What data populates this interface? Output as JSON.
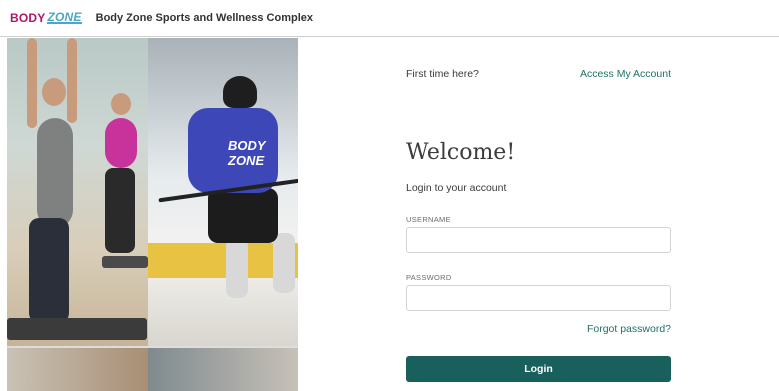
{
  "header": {
    "logo_body": "BODY",
    "logo_zone": "ZONE",
    "title": "Body Zone Sports and Wellness Complex"
  },
  "photos": {
    "jersey_text": "BODY ZONE"
  },
  "form": {
    "first_time": "First time here?",
    "access_link": "Access My Account",
    "welcome": "Welcome!",
    "subtitle": "Login to your account",
    "username_label": "USERNAME",
    "username_value": "",
    "password_label": "PASSWORD",
    "password_value": "",
    "forgot": "Forgot password?",
    "login_button": "Login"
  },
  "colors": {
    "brand_magenta": "#b0156a",
    "brand_cyan": "#4aa7c7",
    "accent_teal": "#19605c",
    "link_teal": "#1e7268"
  }
}
